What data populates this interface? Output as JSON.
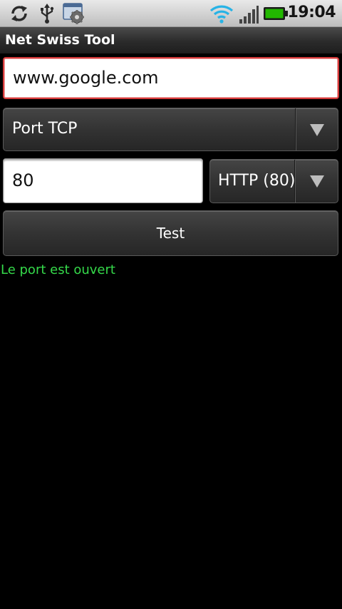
{
  "status_bar": {
    "time": "19:04",
    "icons": [
      "sync-icon",
      "usb-icon",
      "settings-notification-icon",
      "wifi-icon",
      "signal-icon",
      "battery-icon"
    ],
    "battery_color": "#22b800",
    "wifi_color": "#27b3e6"
  },
  "app": {
    "title": "Net Swiss Tool"
  },
  "form": {
    "host_value": "www.google.com",
    "protocol_selected": "Port TCP",
    "port_value": "80",
    "service_selected": "HTTP (80)",
    "test_label": "Test"
  },
  "result": {
    "message": "Le port est ouvert",
    "color": "#35d94a"
  },
  "colors": {
    "background": "#000000",
    "input_focus_border": "#d63a3a"
  }
}
